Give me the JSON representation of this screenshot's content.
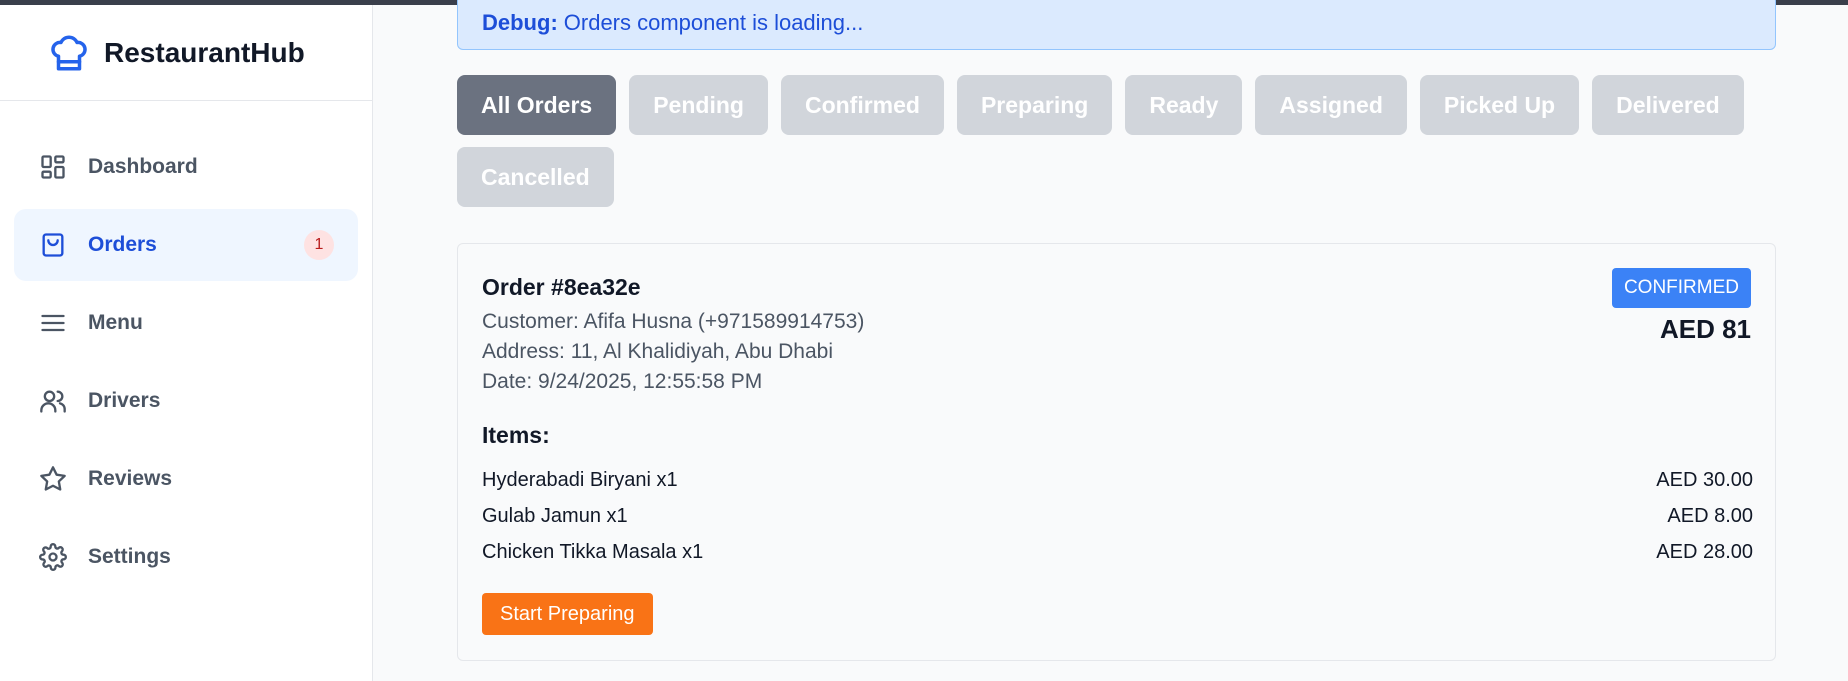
{
  "app": {
    "name": "RestaurantHub",
    "icon": "chef-hat-icon"
  },
  "sidebar": {
    "items": [
      {
        "label": "Dashboard",
        "icon": "dashboard-icon"
      },
      {
        "label": "Orders",
        "icon": "shopping-bag-icon",
        "badge": "1",
        "active": true
      },
      {
        "label": "Menu",
        "icon": "menu-icon"
      },
      {
        "label": "Drivers",
        "icon": "users-icon"
      },
      {
        "label": "Reviews",
        "icon": "star-icon"
      },
      {
        "label": "Settings",
        "icon": "gear-icon"
      }
    ]
  },
  "debug": {
    "prefix": "Debug:",
    "message": "Orders component is loading..."
  },
  "filters": {
    "tabs": [
      "All Orders",
      "Pending",
      "Confirmed",
      "Preparing",
      "Ready",
      "Assigned",
      "Picked Up",
      "Delivered",
      "Cancelled"
    ],
    "active": "All Orders"
  },
  "order": {
    "title": "Order #8ea32e",
    "customer": "Customer: Afifa Husna (+971589914753)",
    "address": "Address: 11, Al Khalidiyah, Abu Dhabi",
    "date": "Date: 9/24/2025, 12:55:58 PM",
    "status": "CONFIRMED",
    "total": "AED 81",
    "items_heading": "Items:",
    "items": [
      {
        "name": "Hyderabadi Biryani x1",
        "price": "AED 30.00"
      },
      {
        "name": "Gulab Jamun x1",
        "price": "AED 8.00"
      },
      {
        "name": "Chicken Tikka Masala x1",
        "price": "AED 28.00"
      }
    ],
    "action": "Start Preparing"
  },
  "colors": {
    "accent": "#2563eb",
    "status_confirmed": "#3b82f6",
    "action_orange": "#f97316",
    "filter_active": "#6b7280",
    "filter_inactive": "#d1d5db"
  }
}
